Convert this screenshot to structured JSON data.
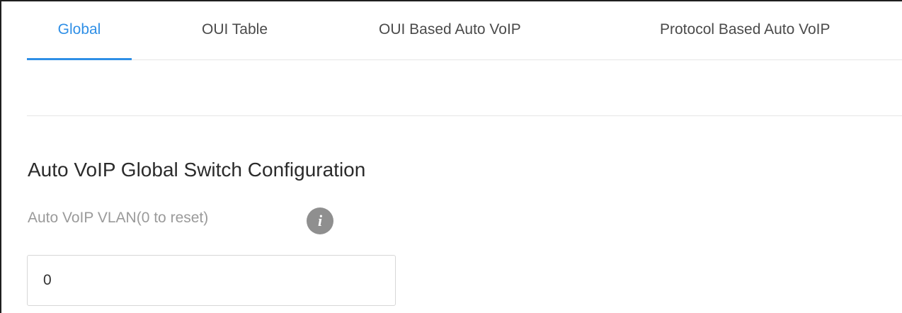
{
  "tabs": [
    {
      "label": "Global",
      "active": true
    },
    {
      "label": "OUI Table",
      "active": false
    },
    {
      "label": "OUI Based Auto VoIP",
      "active": false
    },
    {
      "label": "Protocol Based Auto VoIP",
      "active": false
    }
  ],
  "section": {
    "title": "Auto VoIP Global Switch Configuration"
  },
  "vlan_field": {
    "label": "Auto VoIP VLAN(0 to reset)",
    "info_icon": "info-icon",
    "info_glyph": "i",
    "value": "0"
  },
  "colors": {
    "accent": "#2f8fe6",
    "tab_text": "#4a4a4a",
    "label_text": "#9a9a9a",
    "icon_bg": "#8f8f8f"
  }
}
